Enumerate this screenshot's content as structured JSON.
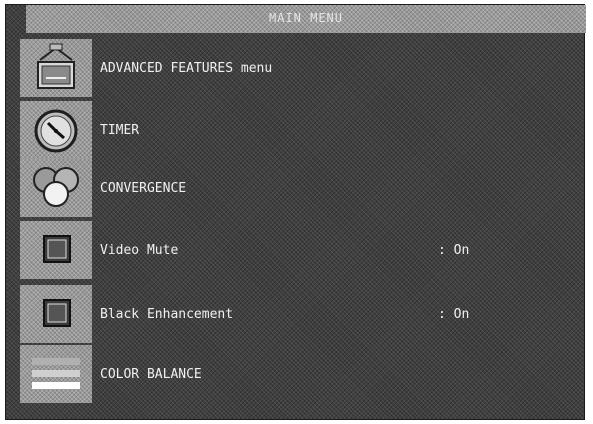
{
  "menu": {
    "title": "MAIN MENU",
    "items": [
      {
        "label": "ADVANCED FEATURES menu",
        "value": "",
        "icon": "advanced-features-icon"
      },
      {
        "label": "TIMER",
        "value": "",
        "icon": "clock-icon"
      },
      {
        "label": "CONVERGENCE",
        "value": "",
        "icon": "convergence-icon"
      },
      {
        "label": "Video Mute",
        "value": ": On",
        "icon": "video-mute-icon"
      },
      {
        "label": "Black Enhancement",
        "value": ": On",
        "icon": "black-enhancement-icon"
      },
      {
        "label": "COLOR BALANCE",
        "value": "",
        "icon": "color-balance-icon"
      }
    ]
  }
}
